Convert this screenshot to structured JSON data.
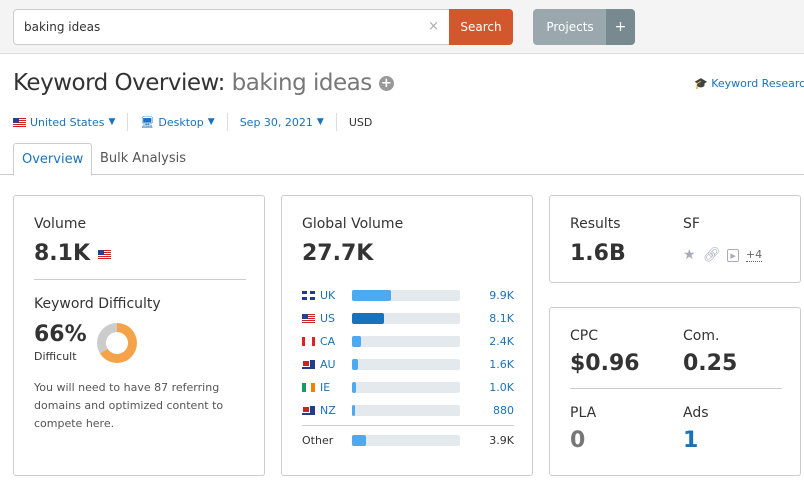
{
  "search": {
    "value": "baking ideas",
    "button": "Search",
    "clear": "×"
  },
  "projects": {
    "label": "Projects",
    "add": "+"
  },
  "title": {
    "prefix": "Keyword Overview:",
    "keyword": "baking ideas",
    "add": "+"
  },
  "keyword_research_link": "Keyword Research",
  "filters": {
    "country": "United States",
    "device": "Desktop",
    "date": "Sep 30, 2021",
    "currency": "USD"
  },
  "tabs": [
    {
      "label": "Overview",
      "active": true
    },
    {
      "label": "Bulk Analysis",
      "active": false
    }
  ],
  "volume": {
    "label": "Volume",
    "value": "8.1K"
  },
  "difficulty": {
    "label": "Keyword Difficulty",
    "value": "66%",
    "level": "Difficult",
    "percent": 66,
    "color": "#f5a34b",
    "note": "You will need to have 87 referring domains and optimized content to compete here."
  },
  "global_volume": {
    "label": "Global Volume",
    "value": "27.7K",
    "countries": [
      {
        "code": "UK",
        "flag": "uk",
        "value": "9.9K",
        "share": 36
      },
      {
        "code": "US",
        "flag": "us",
        "value": "8.1K",
        "share": 30,
        "highlight": true
      },
      {
        "code": "CA",
        "flag": "ca",
        "value": "2.4K",
        "share": 8
      },
      {
        "code": "AU",
        "flag": "au",
        "value": "1.6K",
        "share": 6
      },
      {
        "code": "IE",
        "flag": "ie",
        "value": "1.0K",
        "share": 4
      },
      {
        "code": "NZ",
        "flag": "nz",
        "value": "880",
        "share": 3
      }
    ],
    "other": {
      "label": "Other",
      "value": "3.9K",
      "share": 13
    }
  },
  "results": {
    "label": "Results",
    "value": "1.6B"
  },
  "sf": {
    "label": "SF",
    "icons": [
      "star-icon",
      "link-icon",
      "video-icon"
    ],
    "more": "+4"
  },
  "cpc": {
    "label": "CPC",
    "value": "$0.96"
  },
  "com": {
    "label": "Com.",
    "value": "0.25"
  },
  "pla": {
    "label": "PLA",
    "value": "0"
  },
  "ads": {
    "label": "Ads",
    "value": "1"
  }
}
